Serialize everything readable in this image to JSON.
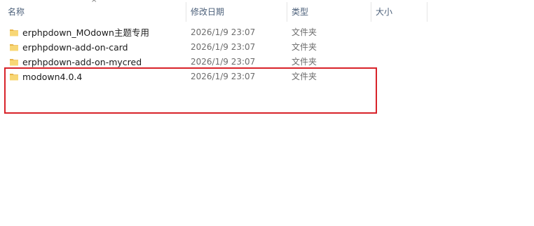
{
  "columns": {
    "name": "名称",
    "modified": "修改日期",
    "type": "类型",
    "size": "大小"
  },
  "sort_indicator": "^",
  "files": [
    {
      "name": "erphpdown_MOdown主题专用",
      "modified": "2026/1/9 23:07",
      "type": "文件夹",
      "icon": "folder-icon"
    },
    {
      "name": "erphpdown-add-on-card",
      "modified": "2026/1/9 23:07",
      "type": "文件夹",
      "icon": "folder-icon"
    },
    {
      "name": "erphpdown-add-on-mycred",
      "modified": "2026/1/9 23:07",
      "type": "文件夹",
      "icon": "folder-icon"
    },
    {
      "name": "modown4.0.4",
      "modified": "2026/1/9 23:07",
      "type": "文件夹",
      "icon": "folder-icon"
    }
  ],
  "colors": {
    "header_text": "#4c607a",
    "folder_yellow": "#f8d775",
    "highlight_border": "#d8232a"
  }
}
